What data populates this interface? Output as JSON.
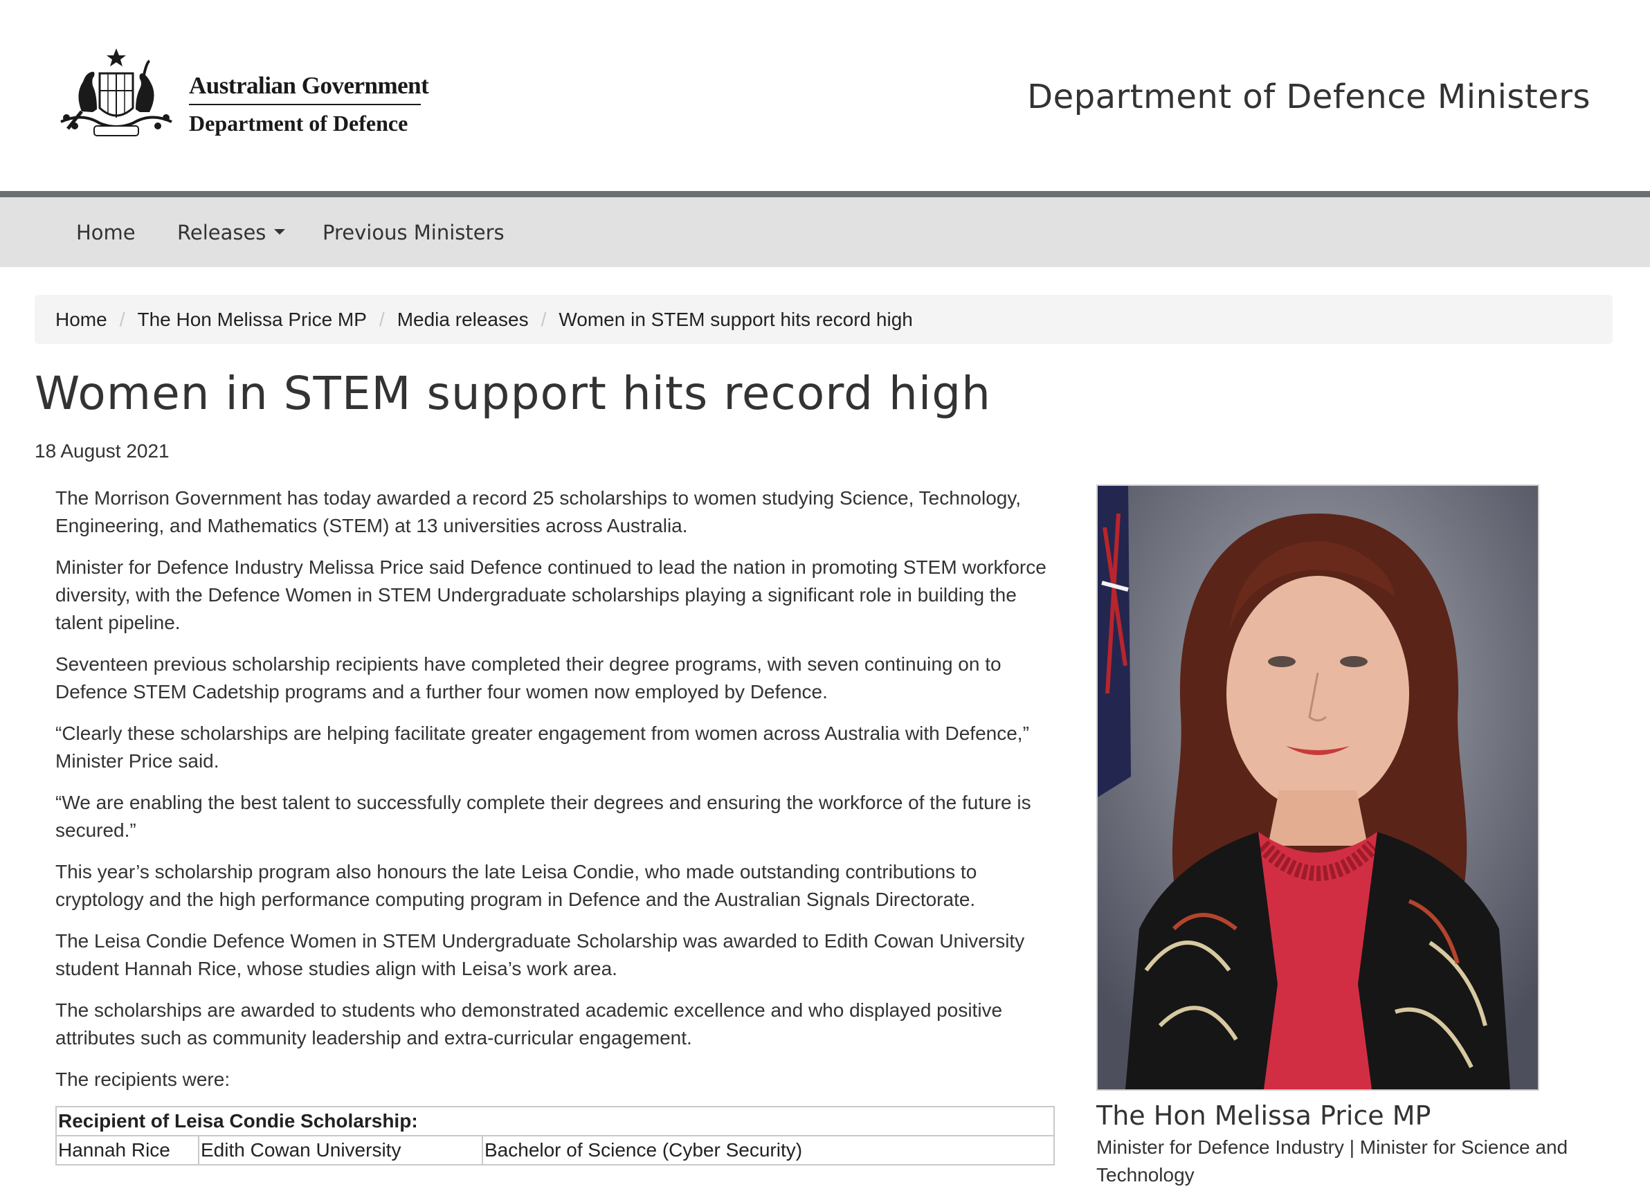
{
  "header": {
    "logo_line1": "Australian Government",
    "logo_line2": "Department of Defence",
    "site_title": "Department of Defence Ministers"
  },
  "nav": {
    "home": "Home",
    "releases": "Releases",
    "previous_ministers": "Previous Ministers"
  },
  "breadcrumb": {
    "items": [
      "Home",
      "The Hon Melissa Price MP",
      "Media releases",
      "Women in STEM support hits record high"
    ],
    "separator": "/"
  },
  "article": {
    "title": "Women in STEM support hits record high",
    "date": "18 August 2021",
    "paragraphs": [
      "The Morrison Government has today awarded a record 25 scholarships to women studying Science, Technology, Engineering, and Mathematics (STEM) at 13 universities across Australia.",
      "Minister for Defence Industry Melissa Price said Defence continued to lead the nation in promoting STEM workforce diversity, with the Defence Women in STEM Undergraduate scholarships playing a significant role in building the talent pipeline.",
      "Seventeen previous scholarship recipients have completed their degree programs, with seven continuing on to Defence STEM Cadetship programs and a further four women now employed by Defence.",
      "“Clearly these scholarships are helping facilitate greater engagement from women across Australia with Defence,” Minister Price said.",
      "“We are enabling the best talent to successfully complete their degrees and ensuring the workforce of the future is secured.”",
      "This year’s scholarship program also honours the late Leisa Condie, who made outstanding contributions to cryptology and the high performance computing program in Defence and the Australian Signals Directorate.",
      "The Leisa Condie Defence Women in STEM Undergraduate Scholarship was awarded to Edith Cowan University student Hannah Rice, whose studies align with Leisa’s work area.",
      "The scholarships are awarded to students who demonstrated academic excellence and who displayed positive attributes such as community leadership and extra-curricular engagement.",
      "The recipients were:"
    ]
  },
  "table": {
    "header": "Recipient of Leisa Condie Scholarship:",
    "rows": [
      [
        "Hannah Rice",
        "Edith Cowan University",
        "Bachelor of Science (Cyber Security)"
      ]
    ]
  },
  "sidebar": {
    "name": "The Hon Melissa Price MP",
    "role": "Minister for Defence Industry | Minister for Science and Technology"
  },
  "colors": {
    "nav_bg": "#e1e1e1",
    "nav_rule": "#6b6e73",
    "breadcrumb_bg": "#f4f4f4",
    "text": "#333333"
  }
}
